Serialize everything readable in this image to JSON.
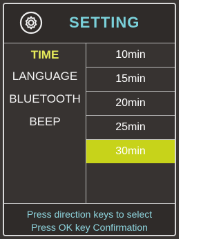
{
  "header": {
    "title": "SETTING",
    "icon": "gear-icon",
    "title_color": "#7ad0d9"
  },
  "menu": {
    "items": [
      {
        "label": "TIME",
        "active": true
      },
      {
        "label": "LANGUAGE",
        "active": false
      },
      {
        "label": "BLUETOOTH",
        "active": false
      },
      {
        "label": "BEEP",
        "active": false
      }
    ],
    "active_color": "#e7ec5a"
  },
  "options": {
    "items": [
      "10min",
      "15min",
      "20min",
      "25min",
      "30min"
    ],
    "selected": "30min",
    "selected_color": "#c7d31a"
  },
  "footer": {
    "line1": "Press direction keys to select",
    "line2": "Press OK key Confirmation"
  }
}
